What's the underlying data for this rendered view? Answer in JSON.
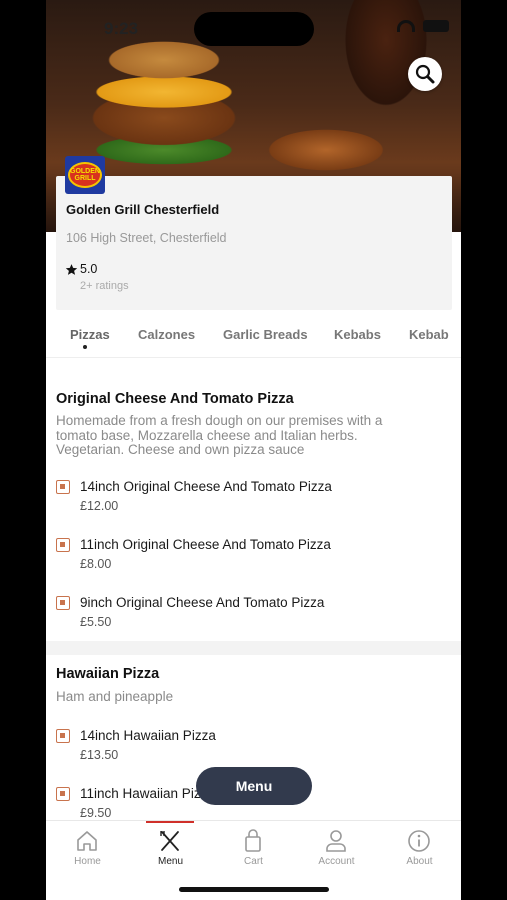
{
  "status_bar": {
    "time": "9:23"
  },
  "restaurant": {
    "logo_text": "GOLDEN GRILL",
    "name": "Golden Grill Chesterfield",
    "address": "106 High Street, Chesterfield",
    "rating": "5.0",
    "ratings_count": "2+ ratings"
  },
  "tabs": [
    "Pizzas",
    "Calzones",
    "Garlic Breads",
    "Kebabs",
    "Kebab"
  ],
  "sections": [
    {
      "title": "Original Cheese And Tomato Pizza",
      "description": "Homemade from a fresh dough on our premises with a tomato base, Mozzarella cheese and Italian herbs. Vegetarian. Cheese and own pizza sauce",
      "items": [
        {
          "name": "14inch Original Cheese And Tomato Pizza",
          "price": "£12.00"
        },
        {
          "name": "11inch Original Cheese And Tomato Pizza",
          "price": "£8.00"
        },
        {
          "name": "9inch Original Cheese And Tomato Pizza",
          "price": "£5.50"
        }
      ]
    },
    {
      "title": "Hawaiian Pizza",
      "description": "Ham and pineapple",
      "items": [
        {
          "name": "14inch Hawaiian Pizza",
          "price": "£13.50"
        },
        {
          "name": "11inch Hawaiian Pizza",
          "price": "£9.50"
        }
      ]
    }
  ],
  "floating_button": "Menu",
  "bottom_nav": [
    {
      "label": "Home",
      "icon": "home-icon"
    },
    {
      "label": "Menu",
      "icon": "cutlery-icon"
    },
    {
      "label": "Cart",
      "icon": "bag-icon"
    },
    {
      "label": "Account",
      "icon": "user-icon"
    },
    {
      "label": "About",
      "icon": "info-icon"
    }
  ],
  "colors": {
    "accent": "#d0302a",
    "fab": "#323a4d",
    "checkbox": "#c8734d"
  }
}
